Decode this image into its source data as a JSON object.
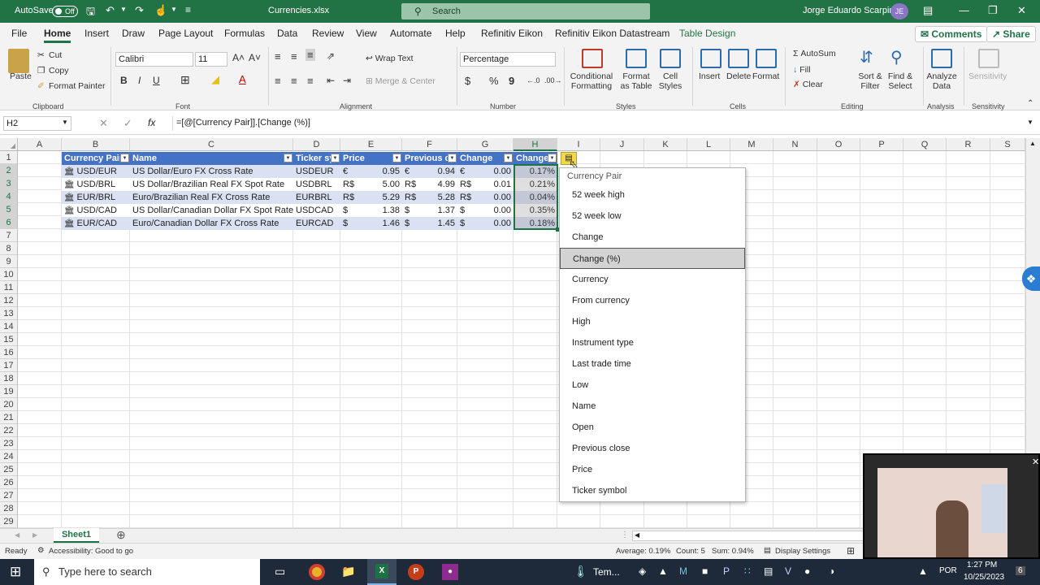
{
  "titlebar": {
    "autosave_label": "AutoSave",
    "autosave_state": "Off",
    "filename": "Currencies.xlsx",
    "search_placeholder": "Search",
    "user_name": "Jorge Eduardo Scarpin",
    "user_initials": "JE"
  },
  "menu": {
    "tabs": [
      "File",
      "Home",
      "Insert",
      "Draw",
      "Page Layout",
      "Formulas",
      "Data",
      "Review",
      "View",
      "Automate",
      "Help",
      "Refinitiv Eikon",
      "Refinitiv Eikon Datastream",
      "Table Design"
    ],
    "active_tab": "Home",
    "comments_label": "Comments",
    "share_label": "Share"
  },
  "ribbon": {
    "clipboard": {
      "paste": "Paste",
      "cut": "Cut",
      "copy": "Copy",
      "format_painter": "Format Painter",
      "group": "Clipboard"
    },
    "font": {
      "family": "Calibri",
      "size": "11",
      "group": "Font"
    },
    "alignment": {
      "wrap": "Wrap Text",
      "merge": "Merge & Center",
      "group": "Alignment"
    },
    "number": {
      "format": "Percentage",
      "group": "Number"
    },
    "styles": {
      "conditional": "Conditional Formatting",
      "format_table": "Format as Table",
      "cell_styles": "Cell Styles",
      "group": "Styles"
    },
    "cells": {
      "insert": "Insert",
      "delete": "Delete",
      "format": "Format",
      "group": "Cells"
    },
    "editing": {
      "autosum": "AutoSum",
      "fill": "Fill",
      "clear": "Clear",
      "sort": "Sort & Filter",
      "find": "Find & Select",
      "group": "Editing"
    },
    "analysis": {
      "analyze": "Analyze Data",
      "group": "Analysis"
    },
    "sensitivity": {
      "label": "Sensitivity",
      "group": "Sensitivity"
    }
  },
  "formula_bar": {
    "name_box": "H2",
    "formula": "=[@[Currency Pair]].[Change (%)]"
  },
  "columns": [
    "A",
    "B",
    "C",
    "D",
    "E",
    "F",
    "G",
    "H",
    "I",
    "J",
    "K",
    "L",
    "M",
    "N",
    "O",
    "P",
    "Q",
    "R",
    "S"
  ],
  "rows": [
    "1",
    "2",
    "3",
    "4",
    "5",
    "6",
    "7",
    "8",
    "9",
    "10",
    "11",
    "12",
    "13",
    "14",
    "15",
    "16",
    "17",
    "18",
    "19",
    "20",
    "21",
    "22",
    "23",
    "24",
    "25",
    "26",
    "27",
    "28",
    "29"
  ],
  "table": {
    "headers": [
      "Currency Pair",
      "Name",
      "Ticker sy",
      "Price",
      "Previous c",
      "Change",
      "Change"
    ],
    "rows": [
      {
        "pair": "USD/EUR",
        "name": "US Dollar/Euro FX Cross Rate",
        "ticker": "USDEUR",
        "price_cur": "€",
        "price": "0.95",
        "prev_cur": "€",
        "prev": "0.94",
        "chg_cur": "€",
        "chg": "0.00",
        "pct": "0.17%"
      },
      {
        "pair": "USD/BRL",
        "name": "US Dollar/Brazilian Real FX Spot Rate",
        "ticker": "USDBRL",
        "price_cur": "R$",
        "price": "5.00",
        "prev_cur": "R$",
        "prev": "4.99",
        "chg_cur": "R$",
        "chg": "0.01",
        "pct": "0.21%"
      },
      {
        "pair": "EUR/BRL",
        "name": "Euro/Brazilian Real FX Cross Rate",
        "ticker": "EURBRL",
        "price_cur": "R$",
        "price": "5.29",
        "prev_cur": "R$",
        "prev": "5.28",
        "chg_cur": "R$",
        "chg": "0.00",
        "pct": "0.04%"
      },
      {
        "pair": "USD/CAD",
        "name": "US Dollar/Canadian Dollar FX Spot Rate",
        "ticker": "USDCAD",
        "price_cur": "$",
        "price": "1.38",
        "prev_cur": "$",
        "prev": "1.37",
        "chg_cur": "$",
        "chg": "0.00",
        "pct": "0.35%"
      },
      {
        "pair": "EUR/CAD",
        "name": "Euro/Canadian Dollar FX Cross Rate",
        "ticker": "EURCAD",
        "price_cur": "$",
        "price": "1.46",
        "prev_cur": "$",
        "prev": "1.45",
        "chg_cur": "$",
        "chg": "0.00",
        "pct": "0.18%"
      }
    ]
  },
  "dropdown": {
    "header": "Currency Pair",
    "items": [
      "52 week high",
      "52 week low",
      "Change",
      "Change (%)",
      "Currency",
      "From currency",
      "High",
      "Instrument type",
      "Last trade time",
      "Low",
      "Name",
      "Open",
      "Previous close",
      "Price",
      "Ticker symbol"
    ],
    "highlighted": "Change (%)"
  },
  "sheet": {
    "tab": "Sheet1"
  },
  "status": {
    "ready": "Ready",
    "accessibility": "Accessibility: Good to go",
    "average": "Average: 0.19%",
    "count": "Count: 5",
    "sum": "Sum: 0.94%",
    "display": "Display Settings"
  },
  "taskbar": {
    "search": "Type here to search",
    "temp": "Tem...",
    "lang": "POR",
    "time": "1:27 PM",
    "date": "10/25/2023",
    "notif": "6"
  },
  "colors": {
    "excel_green": "#217346",
    "table_header": "#4472c4",
    "table_band": "#d9e1f2"
  }
}
